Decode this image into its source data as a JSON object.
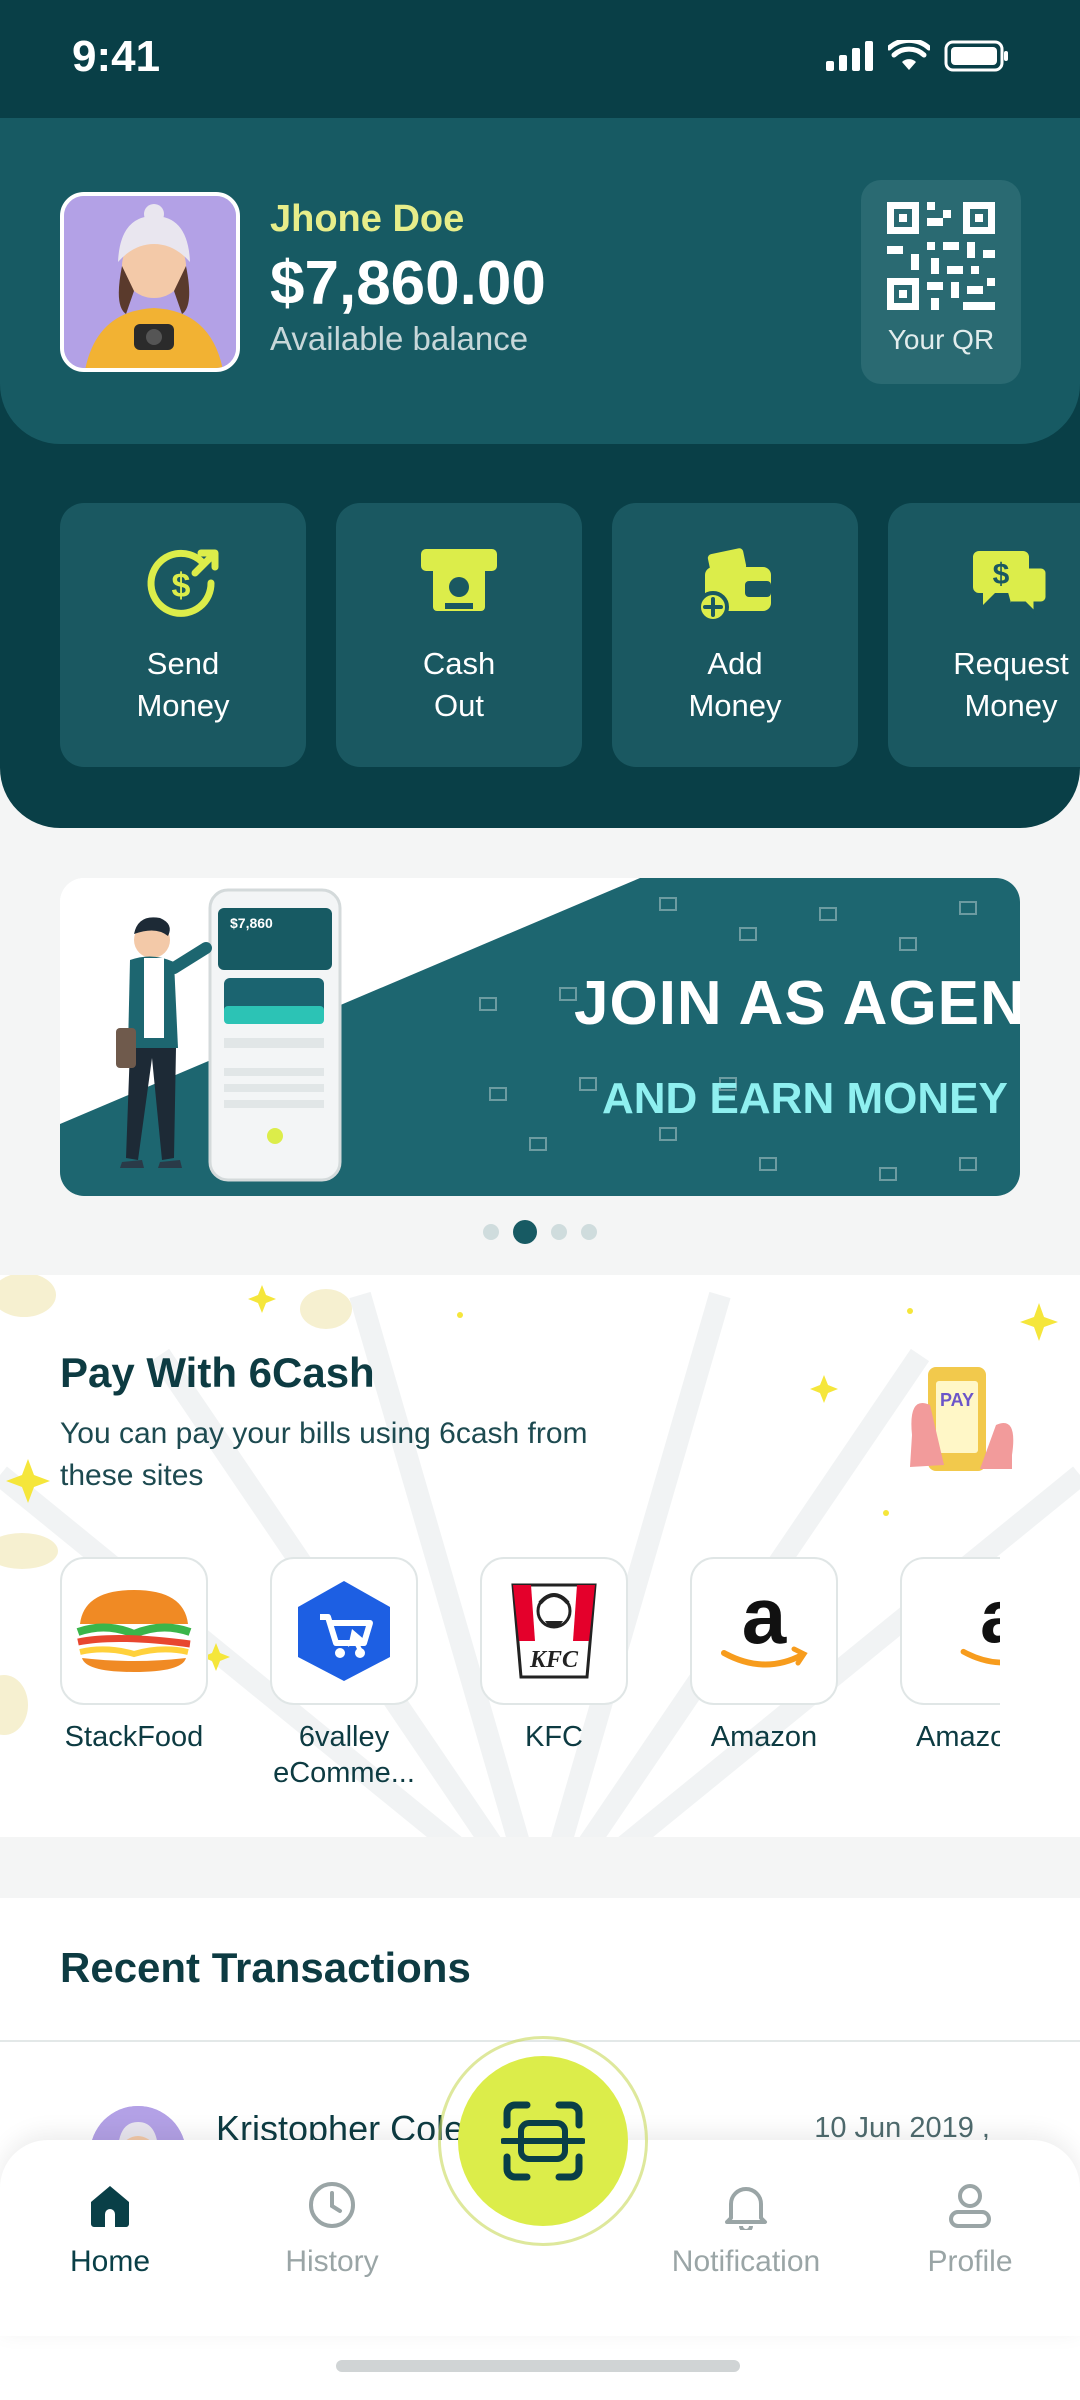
{
  "status_bar": {
    "time": "9:41"
  },
  "profile": {
    "name": "Jhone Doe",
    "balance": "$7,860.00",
    "balance_label": "Available balance",
    "qr_label": "Your QR"
  },
  "actions": [
    {
      "label": "Send\nMoney",
      "icon": "send-money-icon"
    },
    {
      "label": "Cash\nOut",
      "icon": "cash-out-icon"
    },
    {
      "label": "Add\nMoney",
      "icon": "add-money-icon"
    },
    {
      "label": "Request\nMoney",
      "icon": "request-money-icon"
    }
  ],
  "banner": {
    "title": "JOIN AS AGEN",
    "subtitle": "AND EARN MONEY",
    "phone_balance": "$7,860",
    "active_slide": 2,
    "slide_count": 4
  },
  "pay": {
    "title": "Pay With 6Cash",
    "description": "You can pay your bills using 6cash from these sites",
    "pay_badge": "PAY",
    "merchants": [
      {
        "name": "StackFood"
      },
      {
        "name": "6valley eComme..."
      },
      {
        "name": "KFC"
      },
      {
        "name": "Amazon"
      },
      {
        "name": "Amazon"
      }
    ]
  },
  "recent": {
    "title": "Recent Transactions",
    "transactions": [
      {
        "name": "Kristopher Cole",
        "date": "10 Jun 2019 ,"
      }
    ]
  },
  "nav": {
    "items": [
      {
        "label": "Home",
        "icon": "home-icon"
      },
      {
        "label": "History",
        "icon": "history-icon"
      },
      {
        "label": "Notification",
        "icon": "bell-icon"
      },
      {
        "label": "Profile",
        "icon": "profile-icon"
      }
    ],
    "active": "Home"
  },
  "colors": {
    "primary_dark": "#093f47",
    "primary": "#175a63",
    "accent": "#dced4a",
    "name_accent": "#e7ed8a"
  }
}
